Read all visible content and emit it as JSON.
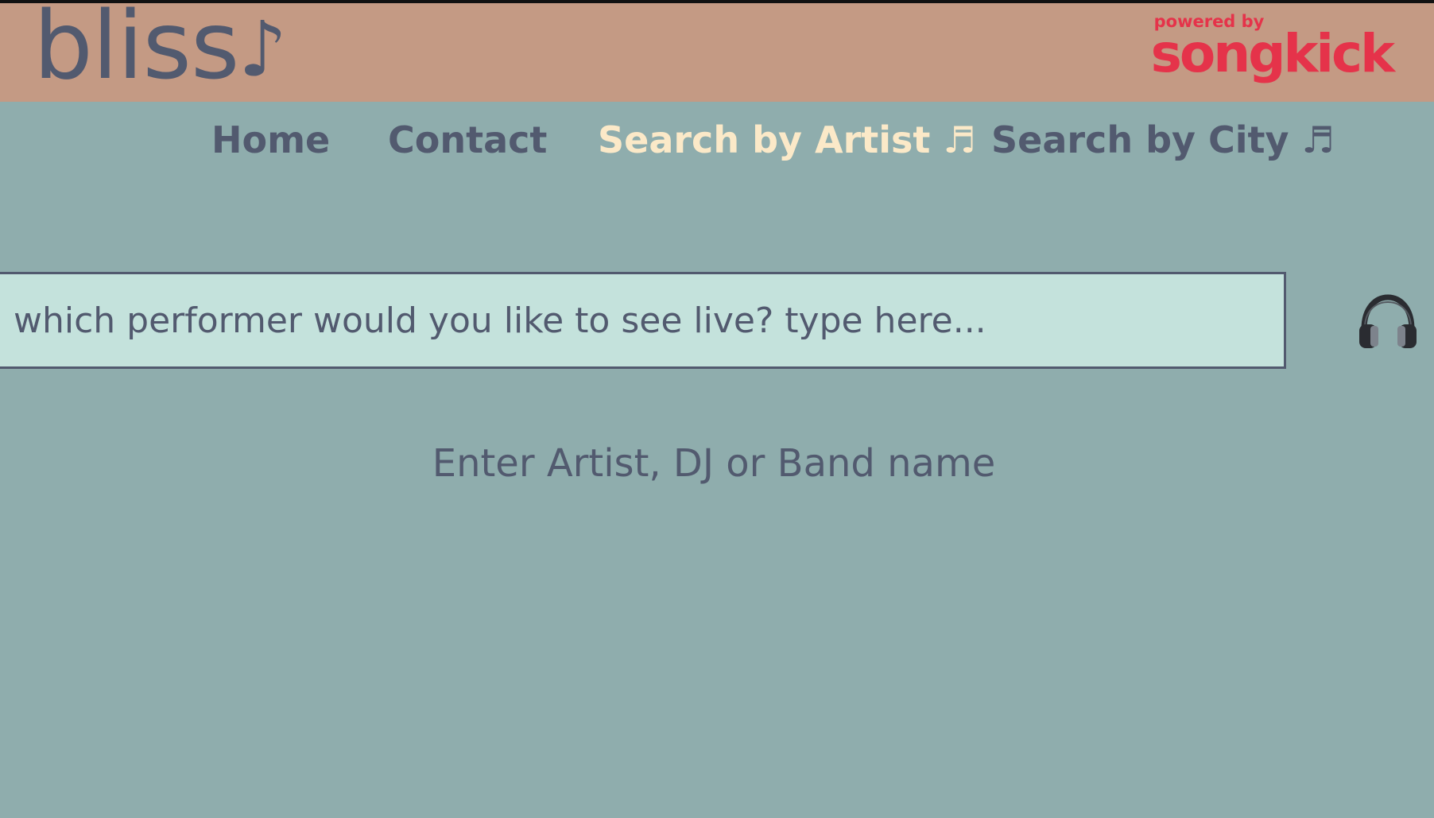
{
  "header": {
    "logo_text": "bliss",
    "logo_note": "♪",
    "powered_by_label": "powered by",
    "powered_by_brand": "songkick"
  },
  "nav": {
    "items": [
      {
        "label": "Home",
        "active": false
      },
      {
        "label": "Contact",
        "active": false
      },
      {
        "label": "Search by Artist ♬",
        "active": true
      },
      {
        "label": "Search by City ♬",
        "active": false
      }
    ]
  },
  "search": {
    "placeholder": "which performer would you like to see live? type here...",
    "value": "",
    "submit_icon": "headphones-icon"
  },
  "hint": "Enter Artist, DJ or Band name",
  "colors": {
    "header_bg": "#c49a84",
    "page_bg": "#8fadad",
    "input_bg": "#c4e2dc",
    "text": "#525a6f",
    "active_nav": "#fbe9c8",
    "brand_red": "#e5334a"
  }
}
